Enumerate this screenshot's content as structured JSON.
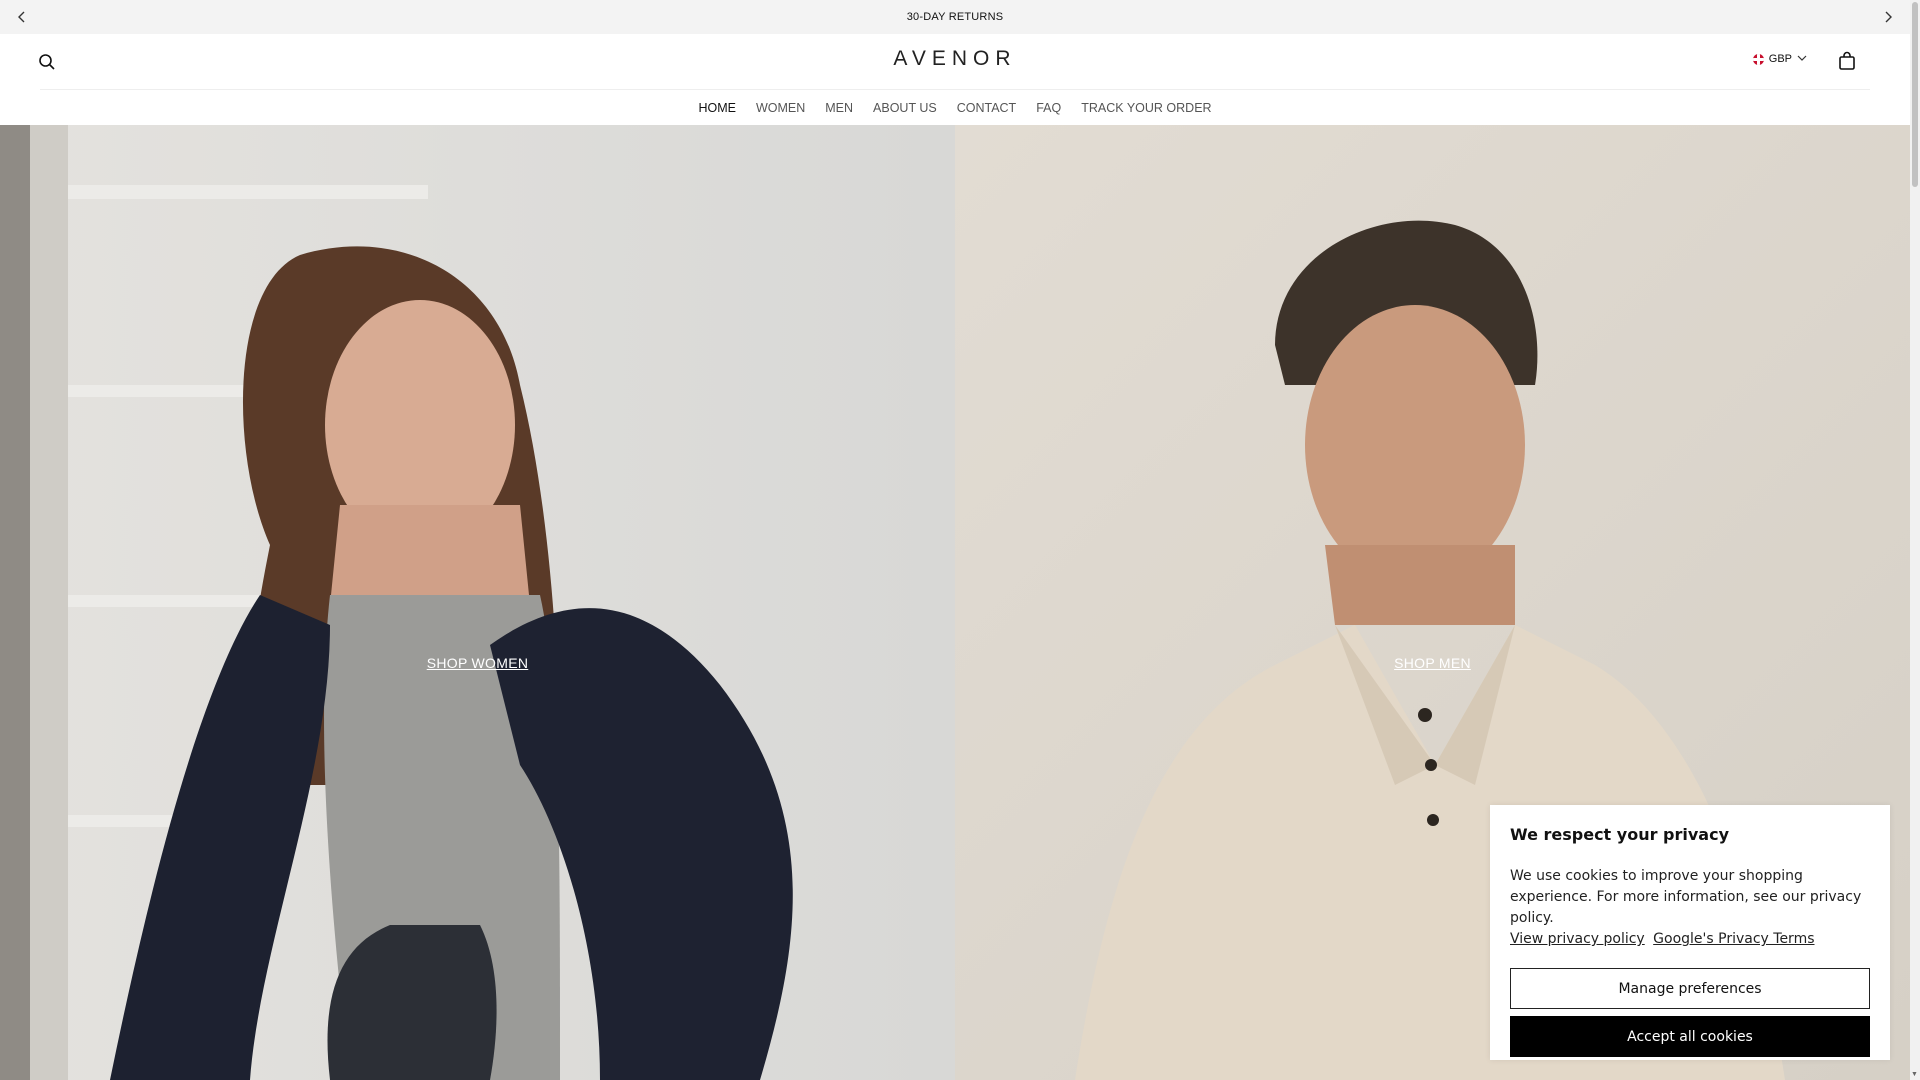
{
  "announcement": {
    "text": "30-DAY RETURNS"
  },
  "header": {
    "logo": "AVENOR",
    "currency": "GBP"
  },
  "nav": {
    "items": [
      {
        "label": "HOME",
        "active": true
      },
      {
        "label": "WOMEN"
      },
      {
        "label": "MEN"
      },
      {
        "label": "ABOUT US"
      },
      {
        "label": "CONTACT"
      },
      {
        "label": "FAQ"
      },
      {
        "label": "TRACK YOUR ORDER"
      }
    ]
  },
  "hero": {
    "women": {
      "cta": "SHOP WOMEN"
    },
    "men": {
      "cta": "SHOP MEN"
    }
  },
  "cookie": {
    "title": "We respect your privacy",
    "body": "We use cookies to improve your shopping experience. For more information, see our privacy policy.",
    "link_privacy": "View privacy policy",
    "link_google": "Google's Privacy Terms",
    "manage": "Manage preferences",
    "accept": "Accept all cookies"
  },
  "colors": {
    "accent": "#000000",
    "announce_bg": "#f3f3f3"
  }
}
